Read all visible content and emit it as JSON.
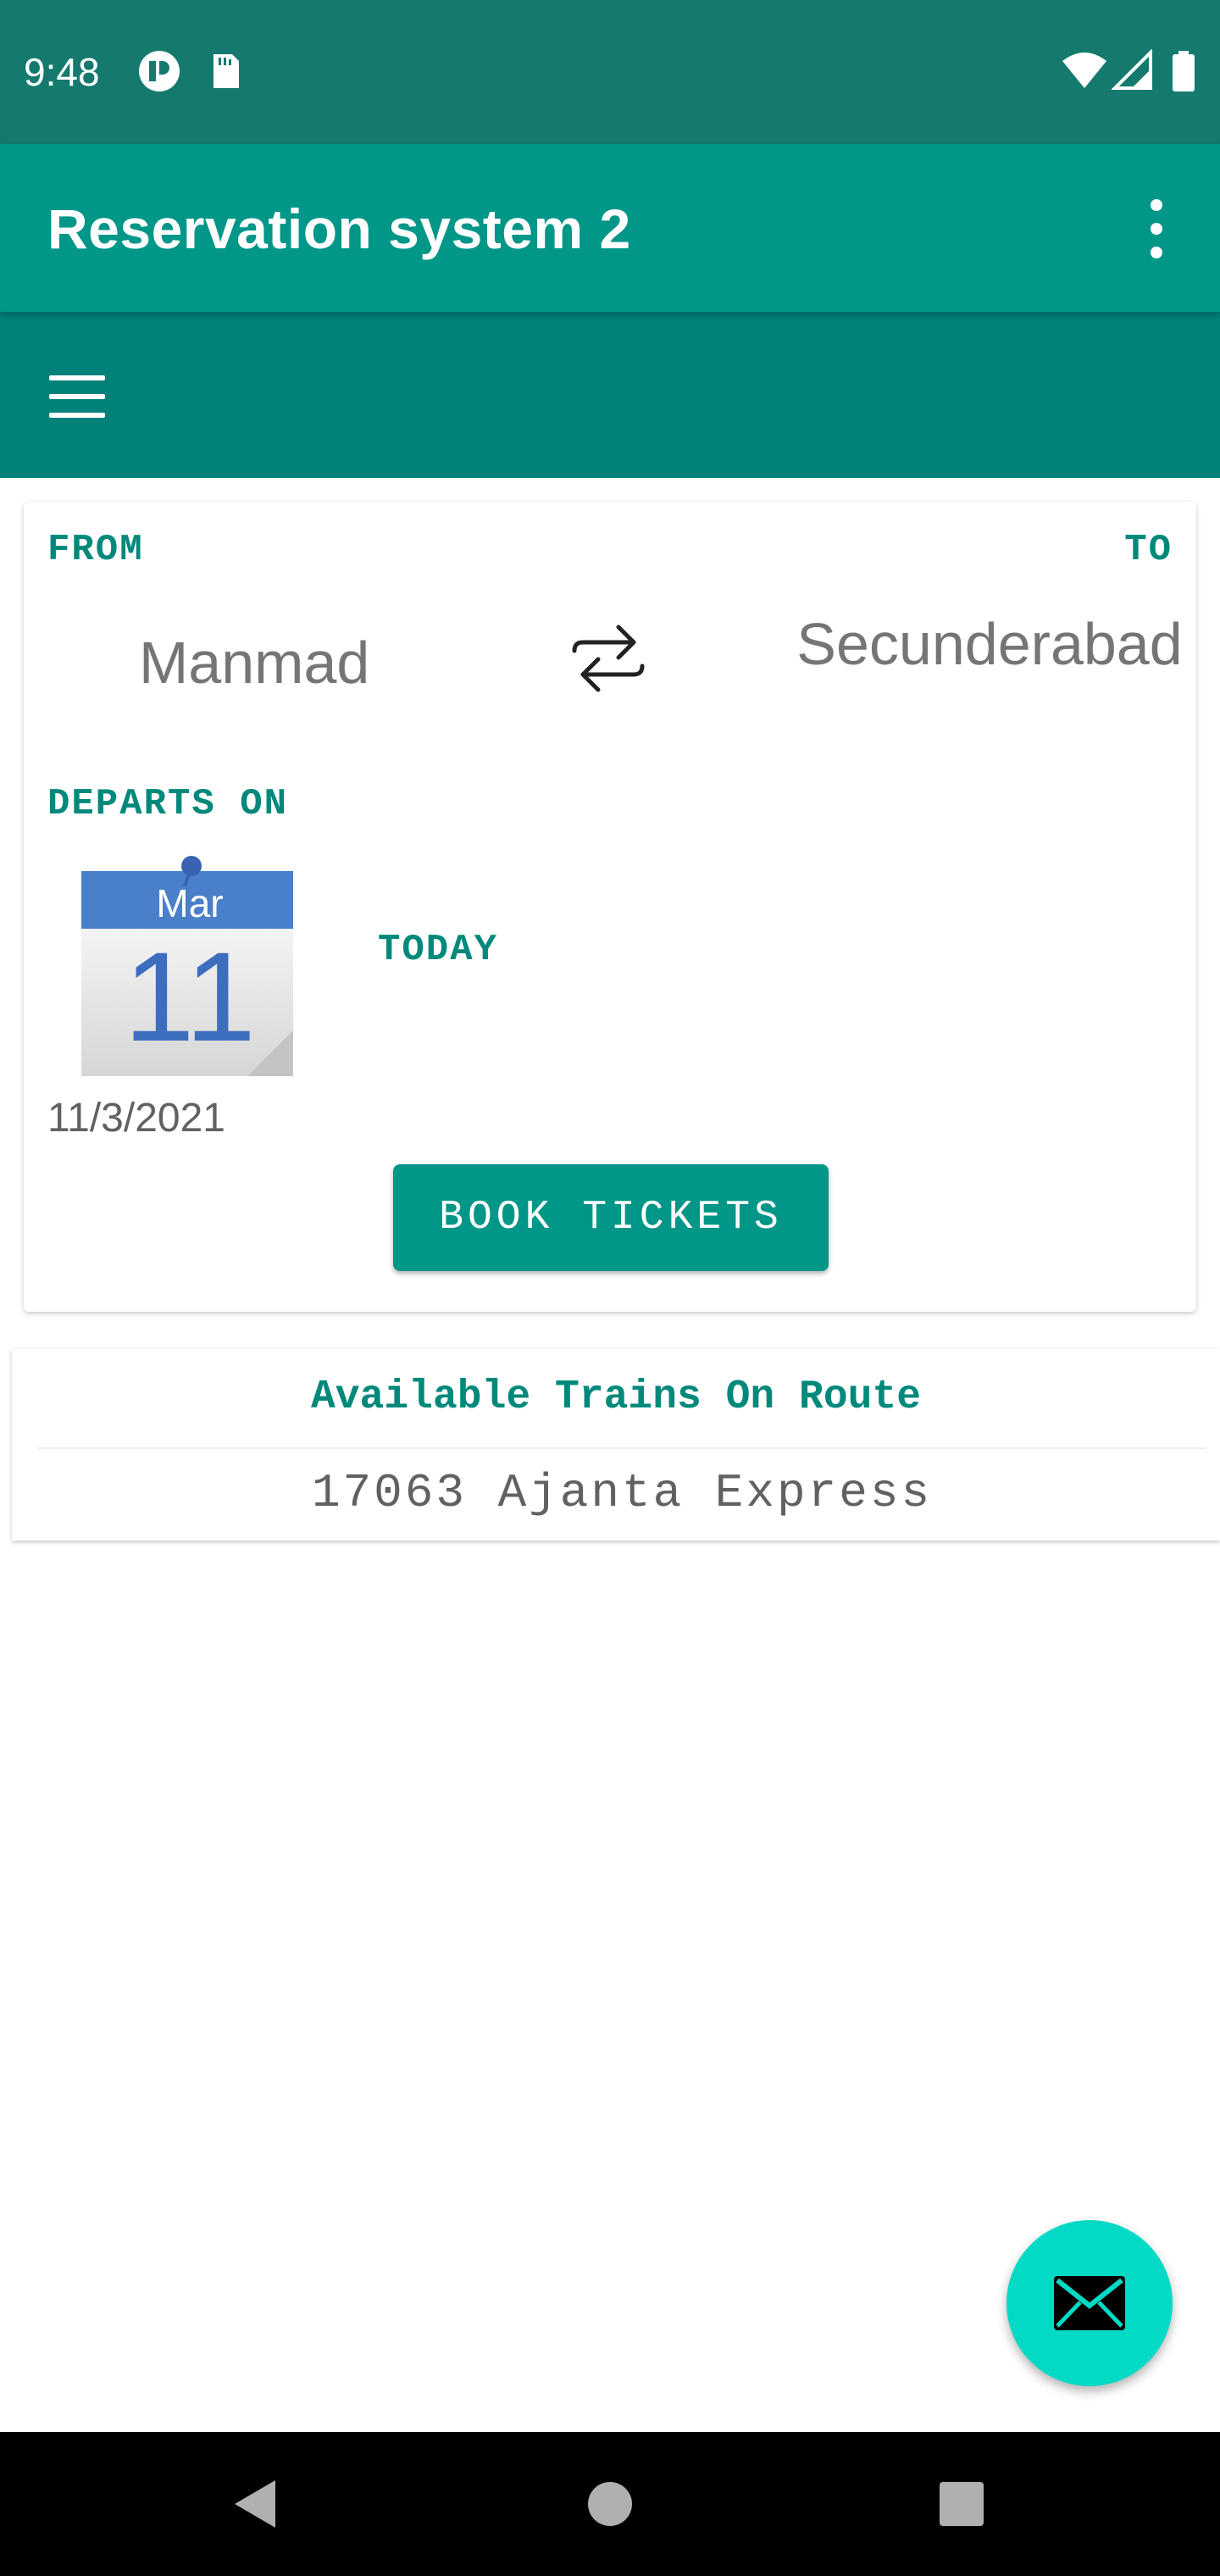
{
  "status_bar": {
    "time": "9:48",
    "left_icons": [
      "notification-app-icon",
      "sd-card-icon"
    ],
    "right_icons": [
      "wifi-icon",
      "cell-signal-icon",
      "battery-icon"
    ],
    "color": "#157a6e"
  },
  "app_bar": {
    "title": "Reservation system 2",
    "overflow_icon": "more-vert-icon",
    "color": "#009688"
  },
  "toolbar": {
    "menu_icon": "hamburger-menu-icon",
    "color": "#00827b"
  },
  "booking": {
    "from_label": "FROM",
    "to_label": "TO",
    "from_city": "Manmad",
    "to_city": "Secunderabad",
    "swap_icon": "swap-arrows-icon",
    "departs_label": "DEPARTS ON",
    "calendar": {
      "month": "Mar",
      "day": "11"
    },
    "today_label": "TODAY",
    "date": "11/3/2021",
    "book_button": "BOOK TICKETS"
  },
  "trains": {
    "header": "Available Trains On Route",
    "items": [
      {
        "name": "17063 Ajanta Express"
      }
    ]
  },
  "fab": {
    "icon": "mail-icon",
    "color": "#03dac5"
  },
  "nav_bar": {
    "icons": [
      "back-triangle-icon",
      "home-circle-icon",
      "recents-square-icon"
    ]
  }
}
